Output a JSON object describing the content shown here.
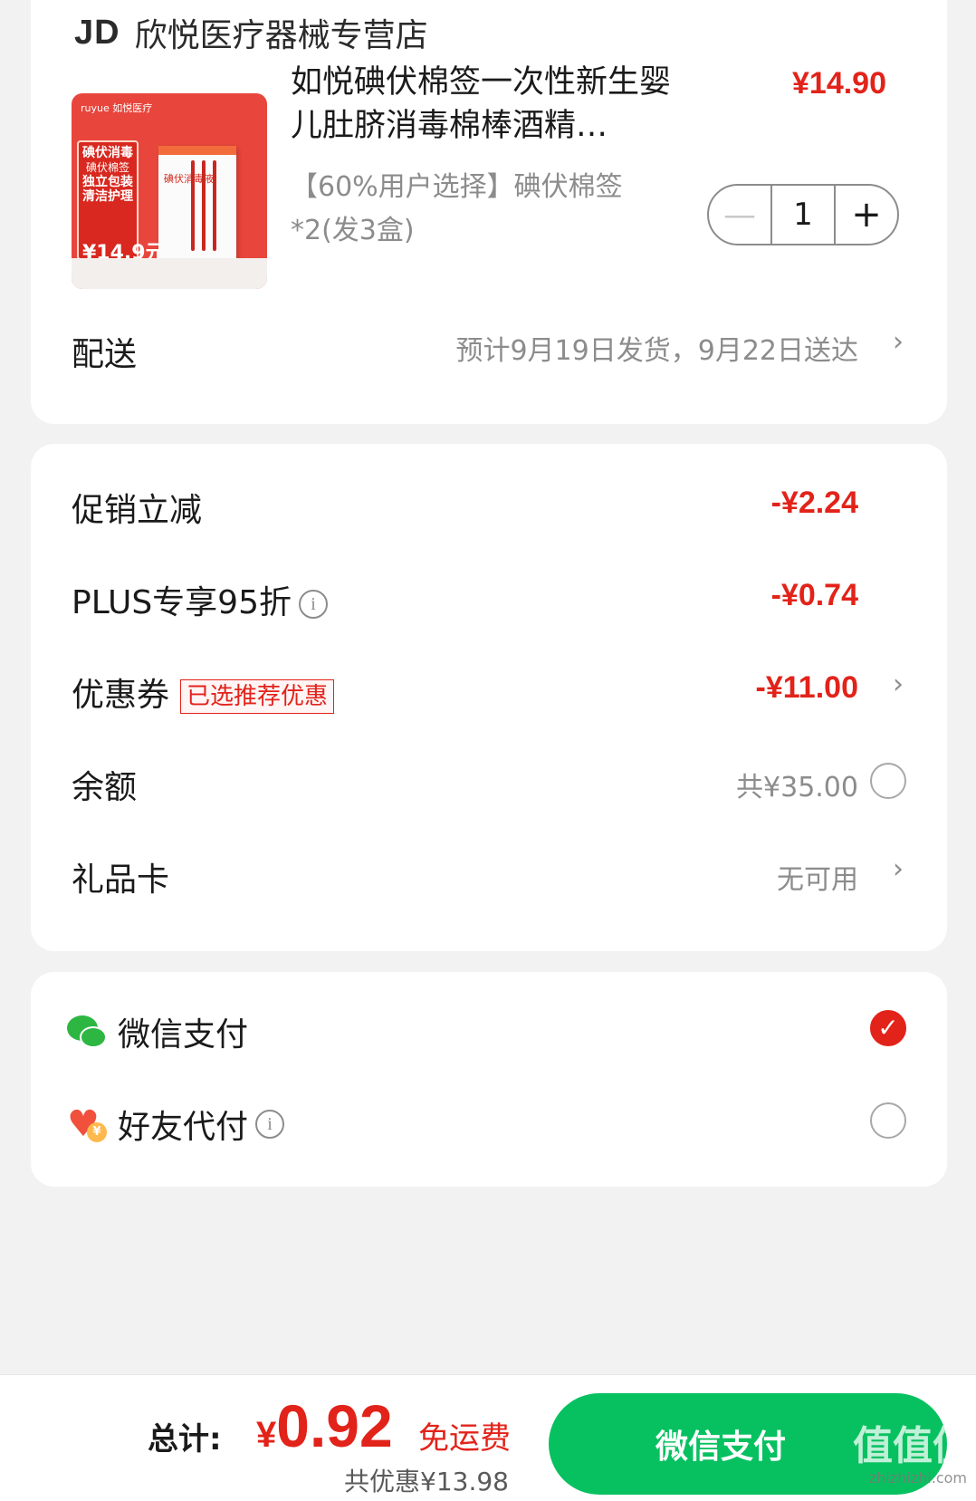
{
  "shop": {
    "logo": "JD",
    "name": "欣悦医疗器械专营店"
  },
  "product": {
    "image": {
      "brand": "ruyue 如悦医疗",
      "badge_line1": "碘伏消毒",
      "badge_line2": "碘伏棉签",
      "badge_line3": "独立包装",
      "badge_line4": "清洁护理",
      "price": "¥14.9元",
      "box_text": "碘伏消毒液"
    },
    "title": "如悦碘伏棉签一次性新生婴儿肚脐消毒棉棒酒精…",
    "price": "¥14.90",
    "spec": "【60%用户选择】碘伏棉签*2(发3盒)",
    "quantity": "1",
    "minus": "—",
    "plus": "+"
  },
  "delivery": {
    "label": "配送",
    "value": "预计9月19日发货，9月22日送达"
  },
  "discounts": {
    "promo": {
      "label": "促销立减",
      "amount": "-¥2.24"
    },
    "plus": {
      "label": "PLUS专享95折",
      "amount": "-¥0.74"
    },
    "coupon": {
      "label": "优惠券",
      "tag": "已选推荐优惠",
      "amount": "-¥11.00"
    },
    "balance": {
      "label": "余额",
      "value": "共¥35.00"
    },
    "giftcard": {
      "label": "礼品卡",
      "value": "无可用"
    }
  },
  "payment": {
    "wechat": {
      "label": "微信支付",
      "selected": true
    },
    "friend": {
      "label": "好友代付",
      "selected": false
    }
  },
  "footer": {
    "total_label": "总计:",
    "currency": "¥",
    "total": "0.92",
    "free_shipping": "免运费",
    "saved": "共优惠¥13.98",
    "pay_button": "微信支付",
    "watermark": "值值值",
    "watermark_sub": "zhizhizhi.com"
  },
  "icons": {
    "chevron": "chevron-right-icon",
    "info": "info-icon",
    "check": "check-icon",
    "wechat": "wechat-pay-icon",
    "friend": "heart-yen-icon"
  },
  "colors": {
    "accent_red": "#e2231a",
    "wechat_green": "#07c160",
    "background": "#f2f2f2"
  }
}
